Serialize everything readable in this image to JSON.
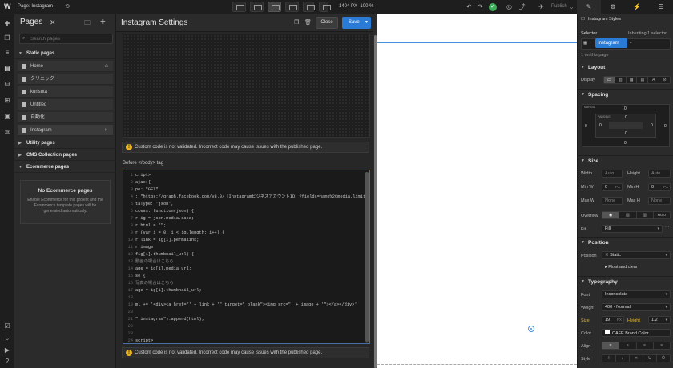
{
  "topbar": {
    "page_label": "Page: Instagram",
    "canvas_width": "1404",
    "canvas_unit": "PX",
    "zoom": "100 %",
    "publish_label": "Publish"
  },
  "pages_panel": {
    "title": "Pages",
    "search_placeholder": "Search pages",
    "static_section": "Static pages",
    "static_pages": [
      "Home",
      "クリニック",
      "kurisuta",
      "Untitled",
      "自動化",
      "Instagram"
    ],
    "utility_section": "Utility pages",
    "cms_section": "CMS Collection pages",
    "ecommerce_section": "Ecommerce pages",
    "ecommerce_empty_title": "No Ecommerce pages",
    "ecommerce_empty_text": "Enable Ecommerce for this project and the Ecommerce template pages will be generated automatically."
  },
  "settings_panel": {
    "title": "Instagram Settings",
    "close_label": "Close",
    "save_label": "Save",
    "warning_text": "Custom code is not validated. Incorrect code may cause issues with the published page.",
    "before_body_label": "Before </body> tag",
    "code_lines": [
      {
        "n": "1",
        "t": "cript>"
      },
      {
        "n": "2",
        "t": "ajax({"
      },
      {
        "n": "3",
        "t": "pe: \"GET\","
      },
      {
        "n": "4",
        "t": ": \"https://graph.facebook.com/v8.0/【InstagramビジネスアカウントID】?fields=name%2Cmedia.limit【表"
      },
      {
        "n": "5",
        "t": "taType: 'json',"
      },
      {
        "n": "6",
        "t": "ccess: function(json) {"
      },
      {
        "n": "7",
        "t": "r ig = json.media.data;"
      },
      {
        "n": "8",
        "t": "r html = \"\";"
      },
      {
        "n": "9",
        "t": "r (var i = 0; i < ig.length; i++) {"
      },
      {
        "n": "10",
        "t": "r link = ig[i].permalink;"
      },
      {
        "n": "11",
        "t": "r image"
      },
      {
        "n": "12",
        "t": "fig[i].thumbnail_url) {"
      },
      {
        "n": "13",
        "t": "動画の場合はこちら"
      },
      {
        "n": "14",
        "t": "age = ig[i].media_url;"
      },
      {
        "n": "15",
        "t": "se {"
      },
      {
        "n": "16",
        "t": "写真の場合はこちら"
      },
      {
        "n": "17",
        "t": "age = ig[i].thumbnail_url;"
      },
      {
        "n": "18",
        "t": ""
      },
      {
        "n": "19",
        "t": "ml += '<div><a href=\"' + link + '\" target=\"_blank\"><img src=\"' + image + '\"></a></div>'"
      },
      {
        "n": "20",
        "t": ""
      },
      {
        "n": "21",
        "t": "\".instagram\").append(html);"
      },
      {
        "n": "22",
        "t": ""
      },
      {
        "n": "23",
        "t": ""
      },
      {
        "n": "24",
        "t": "script>"
      }
    ]
  },
  "style_panel": {
    "class_label": "Instagram Styles",
    "selector_label": "Selector",
    "inheriting_label": "Inheriting 1 selector",
    "selector_chip": "Instagram",
    "on_page": "1 on this page",
    "layout_title": "Layout",
    "display_label": "Display",
    "spacing_title": "Spacing",
    "margin_label": "MARGIN",
    "padding_label": "PADDING",
    "zero": "0",
    "size_title": "Size",
    "width_label": "Width",
    "height_label": "Height",
    "minw_label": "Min W",
    "minh_label": "Min H",
    "maxw_label": "Max W",
    "maxh_label": "Max H",
    "auto": "Auto",
    "none": "None",
    "px": "PX",
    "overflow_label": "Overflow",
    "fit_label": "Fit",
    "fit_value": "Fill",
    "position_title": "Position",
    "position_label": "Position",
    "position_value": "Static",
    "float_label": "Float and clear",
    "typography_title": "Typography",
    "font_label": "Font",
    "font_value": "Inconsolata",
    "weight_label": "Weight",
    "weight_value": "400 - Normal",
    "size_label": "Size",
    "size_value": "19",
    "height_typo_label": "Height",
    "height_typo_value": "1.2",
    "color_label": "Color",
    "color_value": "CAFE Brand Color",
    "align_label": "Align",
    "style_label": "Style"
  },
  "colors": {
    "accent": "#2a7bd6",
    "warning": "#e8b422",
    "ok": "#3fae5a"
  }
}
